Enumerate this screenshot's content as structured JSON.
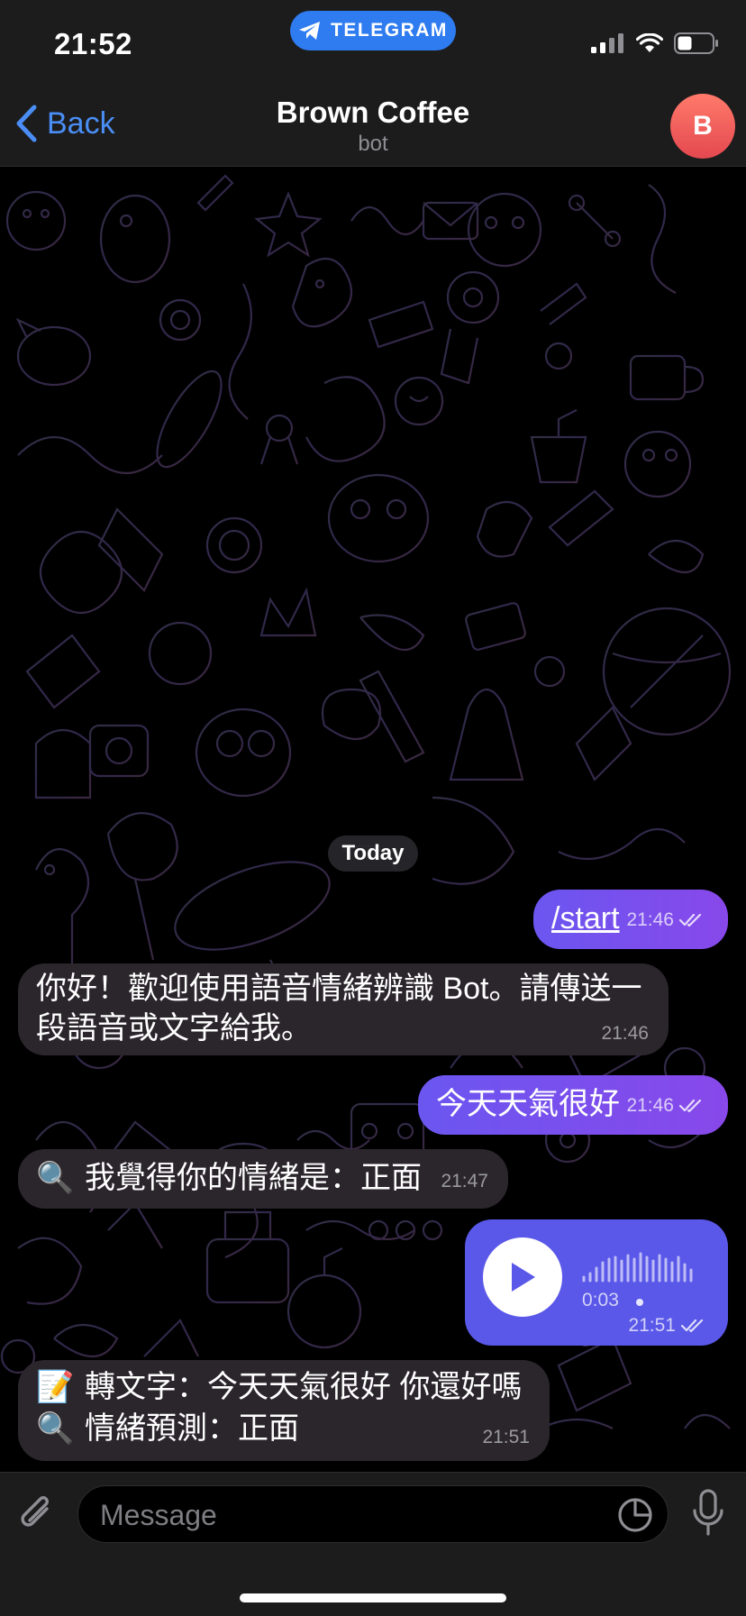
{
  "status": {
    "time": "21:52",
    "banner": "TELEGRAM"
  },
  "header": {
    "back_label": "Back",
    "title": "Brown Coffee",
    "subtitle": "bot",
    "avatar_letter": "B"
  },
  "chat": {
    "date_separator": "Today",
    "messages": [
      {
        "direction": "out",
        "text": "/start",
        "time": "21:46"
      },
      {
        "direction": "in",
        "line1": "你好！歡迎使用語音情緒辨識 Bot。請傳送一",
        "line2": "段語音或文字給我。",
        "time": "21:46"
      },
      {
        "direction": "out",
        "text": "今天天氣很好",
        "time": "21:46"
      },
      {
        "direction": "in",
        "icon": "🔍",
        "text": "我覺得你的情緒是：正面",
        "time": "21:47"
      },
      {
        "direction": "out",
        "type": "voice",
        "duration": "0:03",
        "time": "21:51"
      },
      {
        "direction": "in",
        "icon1": "📝",
        "line1": "轉文字：今天天氣很好 你還好嗎",
        "icon2": "🔍",
        "line2": "情緒預測：正面",
        "time": "21:51"
      }
    ]
  },
  "composer": {
    "placeholder": "Message"
  },
  "colors": {
    "accent": "#4a8ef5",
    "outgoing": "#7a50ec",
    "voice": "#5a58e8",
    "incoming": "#2b262c",
    "avatar": "#ee5a58",
    "banner": "#2f7cf0"
  }
}
